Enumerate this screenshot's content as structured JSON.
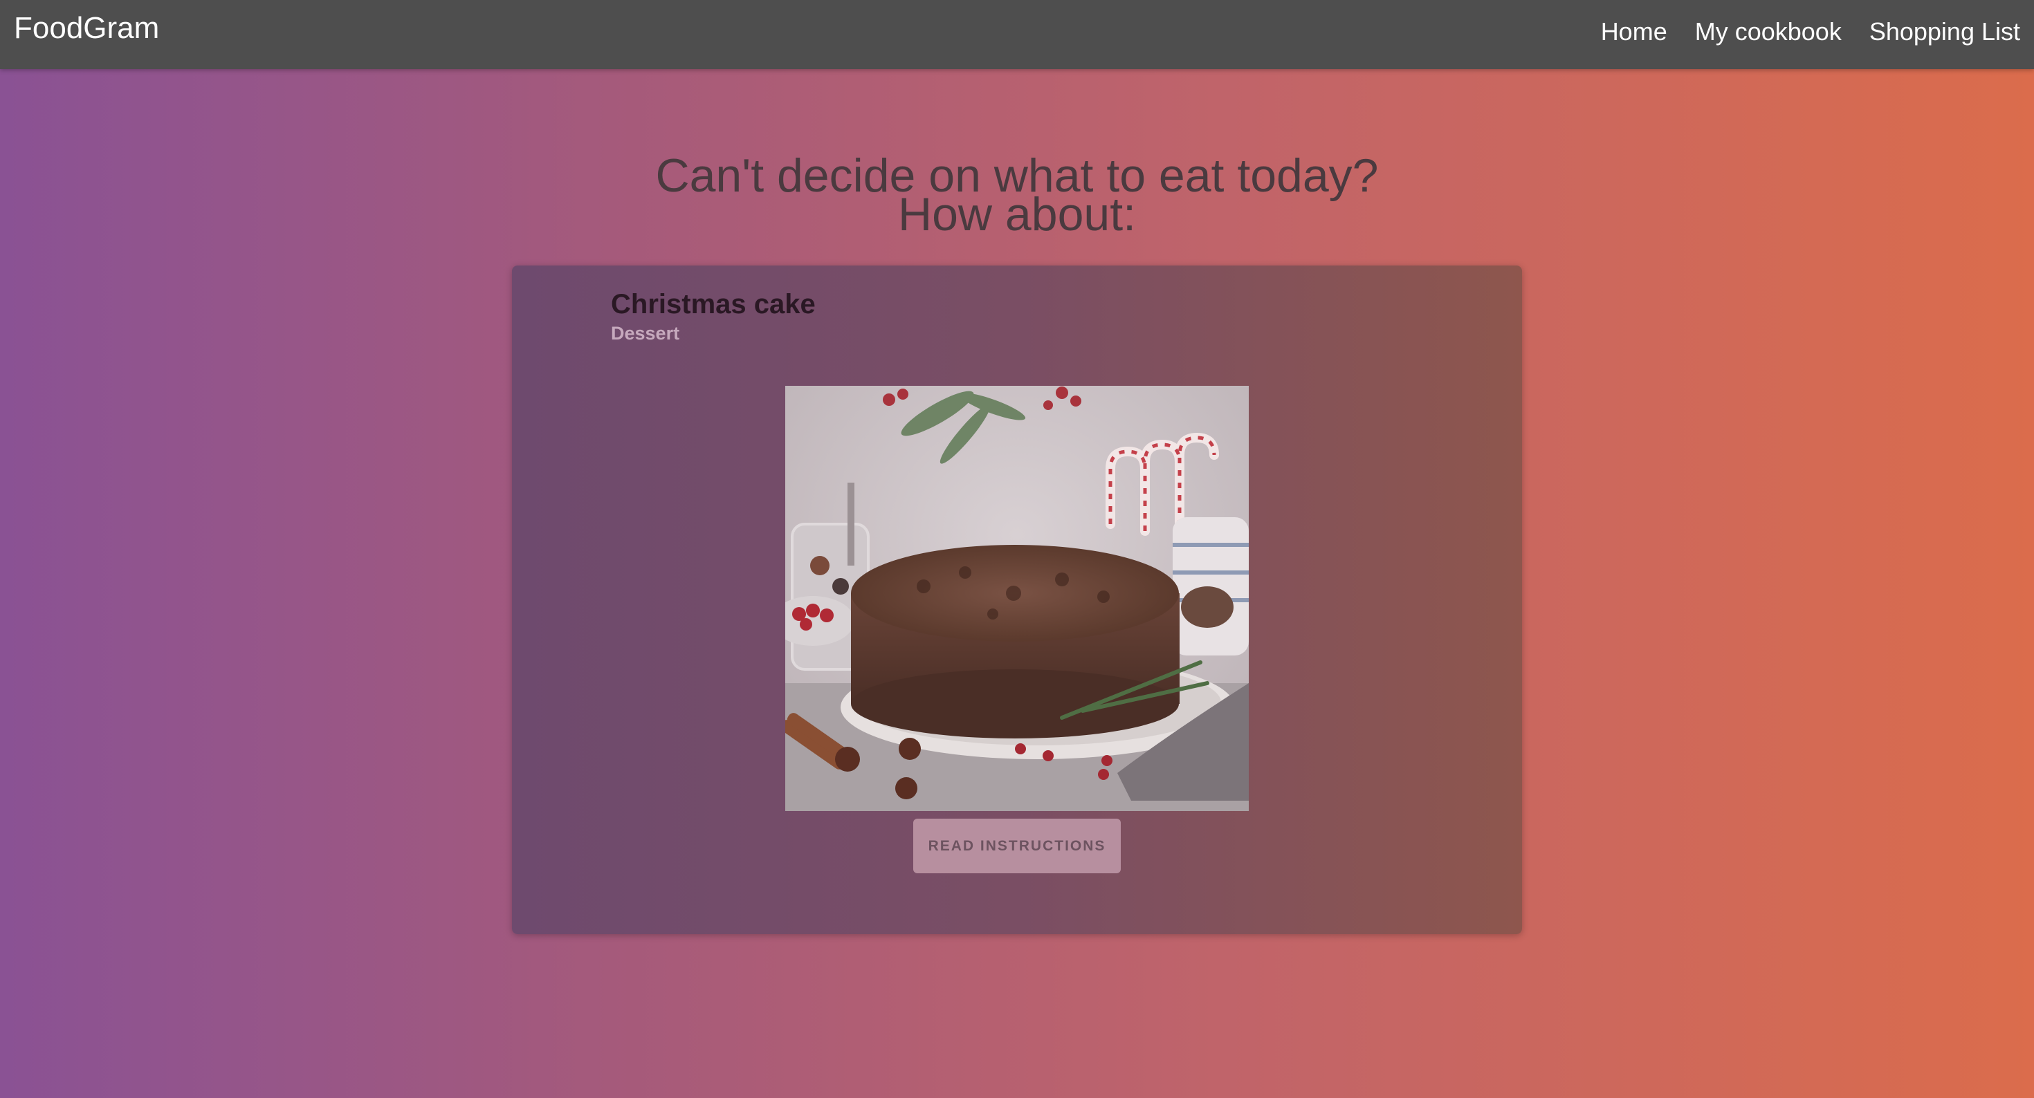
{
  "app": {
    "brand": "FoodGram"
  },
  "nav": {
    "items": [
      {
        "label": "Home"
      },
      {
        "label": "My cookbook"
      },
      {
        "label": "Shopping List"
      }
    ]
  },
  "hero": {
    "line1": "Can't decide on what to eat today?",
    "line2": "How about:"
  },
  "recipe": {
    "title": "Christmas cake",
    "category": "Dessert",
    "image_alt": "Christmas cake",
    "button_label": "READ INSTRUCTIONS"
  },
  "colors": {
    "navbar": "#4e4e4e",
    "gradient_start": "#8a5294",
    "gradient_end": "#db6c4c",
    "headline_text": "#4a3a3f",
    "button": "#b78f9f"
  }
}
